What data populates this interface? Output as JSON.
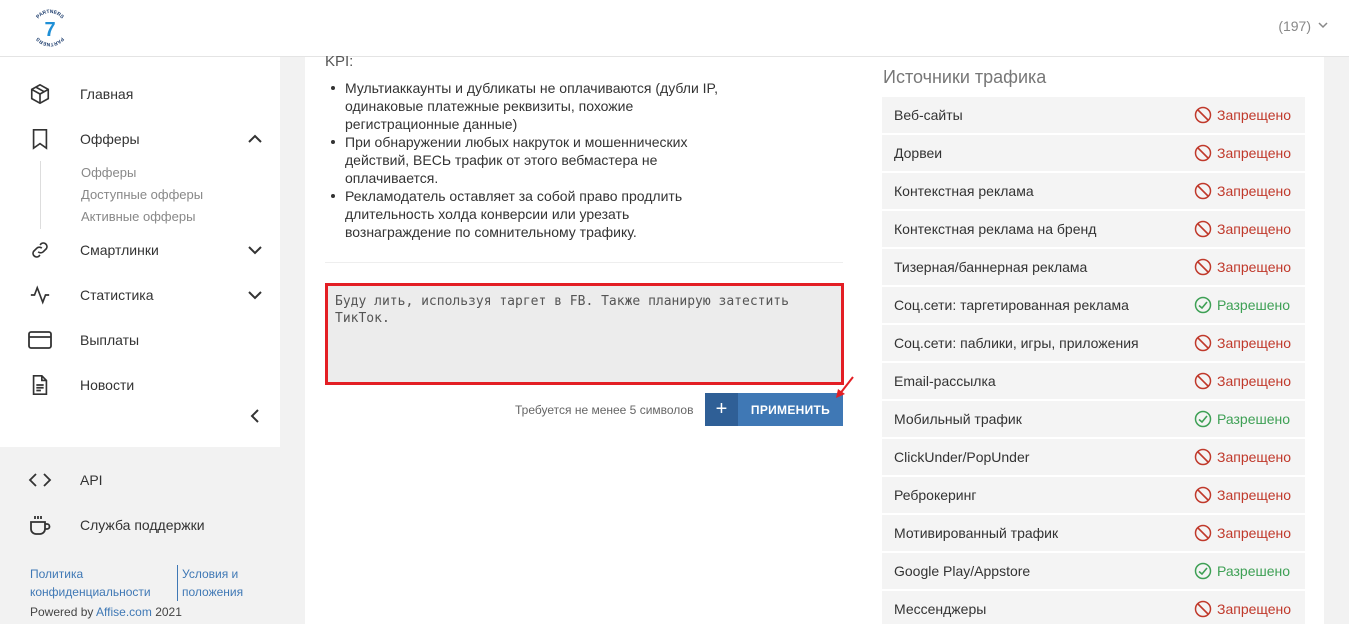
{
  "header": {
    "logo_text": "PARTNERS",
    "logo_number": "7",
    "balance": "(197)"
  },
  "sidebar": {
    "items": [
      {
        "label": "Главная",
        "icon": "cube-icon"
      },
      {
        "label": "Офферы",
        "icon": "bookmark-icon"
      },
      {
        "label": "Смартлинки",
        "icon": "link-icon"
      },
      {
        "label": "Статистика",
        "icon": "activity-icon"
      },
      {
        "label": "Выплаты",
        "icon": "credit-card-icon"
      },
      {
        "label": "Новости",
        "icon": "document-icon"
      }
    ],
    "subitems": [
      "Офферы",
      "Доступные офферы",
      "Активные офферы"
    ],
    "bottom": [
      {
        "label": "API",
        "icon": "code-icon"
      },
      {
        "label": "Служба поддержки",
        "icon": "coffee-icon"
      }
    ],
    "footer": {
      "privacy_line1": "Политика",
      "privacy_line2": "конфиденциальности",
      "terms_line1": "Условия и",
      "terms_line2": "положения",
      "powered_prefix": "Powered by",
      "powered_brand": "Affise.com",
      "powered_year": "2021"
    }
  },
  "main": {
    "kpi_title": "KPI:",
    "kpi_items": [
      "Мультиаккаунты и дубликаты не оплачиваются (дубли IP, одинаковые платежные реквизиты, похожие регистрационные данные)",
      "При обнаружении любых накруток и мошеннических действий, ВЕСЬ трафик от этого вебмастера не оплачивается.",
      "Рекламодатель оставляет за собой право продлить длительность холда конверсии или урезать вознаграждение по сомнительному трафику."
    ],
    "textarea_value": "Буду лить, используя таргет в FB. Также планирую затестить ТикТок.",
    "hint": "Требуется не менее 5 символов",
    "apply_label": "ПРИМЕНИТЬ"
  },
  "traffic": {
    "title": "Источники трафика",
    "forbidden_color": "#c0392b",
    "allowed_color": "#3ea055",
    "rows": [
      {
        "name": "Веб-сайты",
        "status": "Запрещено",
        "allowed": false
      },
      {
        "name": "Дорвеи",
        "status": "Запрещено",
        "allowed": false
      },
      {
        "name": "Контекстная реклама",
        "status": "Запрещено",
        "allowed": false
      },
      {
        "name": "Контекстная реклама на бренд",
        "status": "Запрещено",
        "allowed": false
      },
      {
        "name": "Тизерная/баннерная реклама",
        "status": "Запрещено",
        "allowed": false
      },
      {
        "name": "Соц.сети: таргетированная реклама",
        "status": "Разрешено",
        "allowed": true
      },
      {
        "name": "Соц.сети: паблики, игры, приложения",
        "status": "Запрещено",
        "allowed": false
      },
      {
        "name": "Email-рассылка",
        "status": "Запрещено",
        "allowed": false
      },
      {
        "name": "Мобильный трафик",
        "status": "Разрешено",
        "allowed": true
      },
      {
        "name": "ClickUnder/PopUnder",
        "status": "Запрещено",
        "allowed": false
      },
      {
        "name": "Реброкеринг",
        "status": "Запрещено",
        "allowed": false
      },
      {
        "name": "Мотивированный трафик",
        "status": "Запрещено",
        "allowed": false
      },
      {
        "name": "Google Play/Appstore",
        "status": "Разрешено",
        "allowed": true
      },
      {
        "name": "Мессенджеры",
        "status": "Запрещено",
        "allowed": false
      }
    ]
  }
}
